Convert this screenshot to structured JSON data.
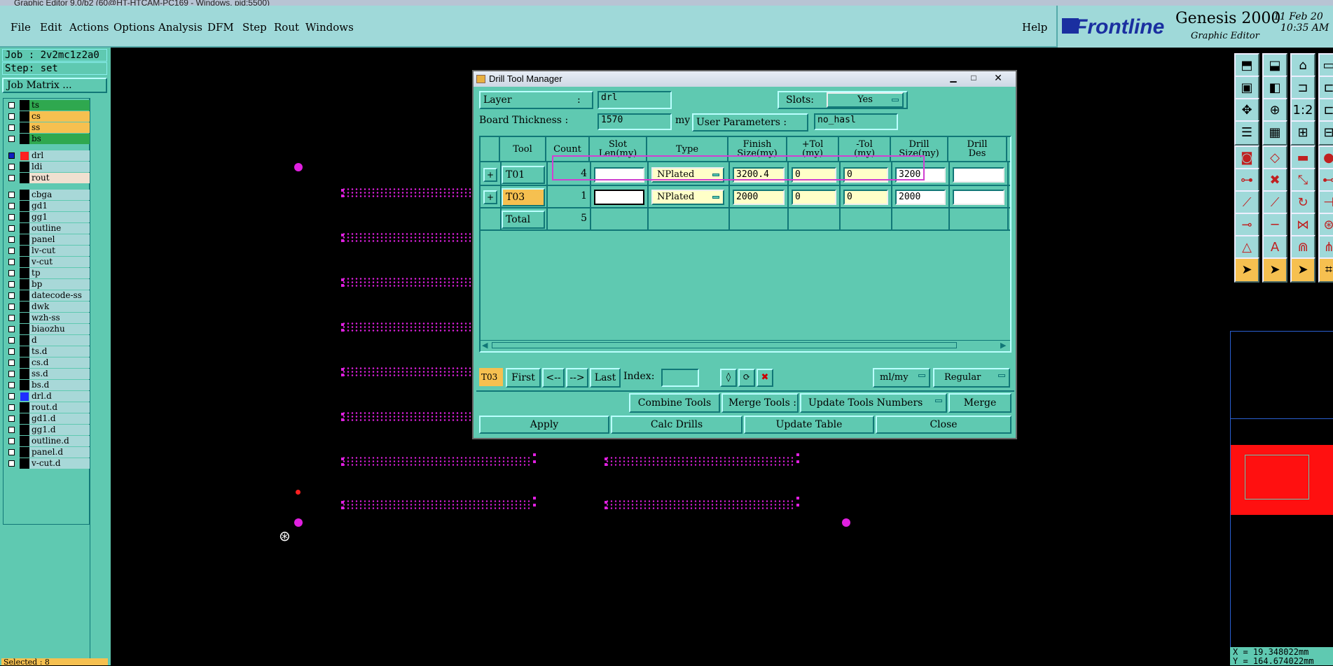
{
  "titlebar": {
    "text": "Graphic Editor 9.0/b2 (60@HT-HTCAM-PC169 - Windows, pid:5500)"
  },
  "menu": {
    "items": [
      "File",
      "Edit",
      "Actions",
      "Options",
      "Analysis",
      "DFM",
      "Step",
      "Rout",
      "Windows"
    ],
    "help": "Help"
  },
  "brand": {
    "logo": "Frontline",
    "product": "Genesis 2000",
    "subtitle": "Graphic Editor",
    "date": "11 Feb 20",
    "time": "10:35 AM"
  },
  "left": {
    "job": "Job : 2v2mc1z2a0",
    "step": "Step: set",
    "job_matrix": "Job Matrix ...",
    "selected": "Selected : 8",
    "layers": [
      {
        "name": "ts",
        "color": "#2fa84f"
      },
      {
        "name": "cs",
        "color": "#f6c050"
      },
      {
        "name": "ss",
        "color": "#f6c050"
      },
      {
        "name": "bs",
        "color": "#2fa84f"
      },
      {
        "name": "drl",
        "color": "#a8d8d8",
        "sw": "#ff2020"
      },
      {
        "name": "ldi",
        "color": "#a8d8d8"
      },
      {
        "name": "rout",
        "color": "#f0e0d0"
      },
      {
        "name": "cbga",
        "color": "#a8d8d8"
      },
      {
        "name": "gd1",
        "color": "#a8d8d8"
      },
      {
        "name": "gg1",
        "color": "#a8d8d8"
      },
      {
        "name": "outline",
        "color": "#a8d8d8"
      },
      {
        "name": "panel",
        "color": "#a8d8d8"
      },
      {
        "name": "lv-cut",
        "color": "#a8d8d8"
      },
      {
        "name": "v-cut",
        "color": "#a8d8d8"
      },
      {
        "name": "tp",
        "color": "#a8d8d8"
      },
      {
        "name": "bp",
        "color": "#a8d8d8"
      },
      {
        "name": "datecode-ss",
        "color": "#a8d8d8"
      },
      {
        "name": "dwk",
        "color": "#a8d8d8"
      },
      {
        "name": "wzh-ss",
        "color": "#a8d8d8"
      },
      {
        "name": "biaozhu",
        "color": "#a8d8d8"
      },
      {
        "name": "d",
        "color": "#a8d8d8"
      },
      {
        "name": "ts.d",
        "color": "#a8d8d8"
      },
      {
        "name": "cs.d",
        "color": "#a8d8d8"
      },
      {
        "name": "ss.d",
        "color": "#a8d8d8"
      },
      {
        "name": "bs.d",
        "color": "#a8d8d8"
      },
      {
        "name": "drl.d",
        "color": "#a8d8d8",
        "sw": "#1f2fff"
      },
      {
        "name": "rout.d",
        "color": "#a8d8d8"
      },
      {
        "name": "gd1.d",
        "color": "#a8d8d8"
      },
      {
        "name": "gg1.d",
        "color": "#a8d8d8"
      },
      {
        "name": "outline.d",
        "color": "#a8d8d8"
      },
      {
        "name": "panel.d",
        "color": "#a8d8d8"
      },
      {
        "name": "v-cut.d",
        "color": "#a8d8d8"
      }
    ]
  },
  "coords": {
    "x": "X = 19.348022mm",
    "y": "Y = 164.674022mm"
  },
  "dialog": {
    "title": "Drill Tool Manager",
    "layer_label": "Layer",
    "layer_colon": ":",
    "layer_value": "drl",
    "slots_label": "Slots:",
    "slots_value": "Yes",
    "board_thickness_label": "Board Thickness :",
    "board_thickness_value": "1570",
    "board_thickness_unit": "my",
    "user_params_label": "User Parameters :",
    "user_params_value": "no_hasl",
    "columns": [
      "Tool",
      "Count",
      "Slot\nLen(my)",
      "Type",
      "Finish\nSize(my)",
      "+Tol\n(my)",
      "-Tol\n(my)",
      "Drill\nSize(my)",
      "Drill\nDes"
    ],
    "rows": [
      {
        "tool": "T01",
        "count": "4",
        "slot_len": "",
        "type": "NPlated",
        "finish": "3200.4",
        "ptol": "0",
        "mtol": "0",
        "drill": "3200",
        "des": ""
      },
      {
        "tool": "T03",
        "count": "1",
        "slot_len": "",
        "type": "NPlated",
        "finish": "2000",
        "ptol": "0",
        "mtol": "0",
        "drill": "2000",
        "des": ""
      }
    ],
    "total_label": "Total",
    "total_count": "5",
    "nav": {
      "current": "T03",
      "first": "First",
      "prev": "<--",
      "next": "-->",
      "last": "Last",
      "index_label": "Index:",
      "units": "ml/my",
      "mode": "Regular"
    },
    "combine": "Combine Tools",
    "merge_tools": "Merge Tools :",
    "update_numbers": "Update Tools Numbers",
    "merge": "Merge",
    "apply": "Apply",
    "calc": "Calc Drills",
    "update_table": "Update Table",
    "close": "Close"
  }
}
